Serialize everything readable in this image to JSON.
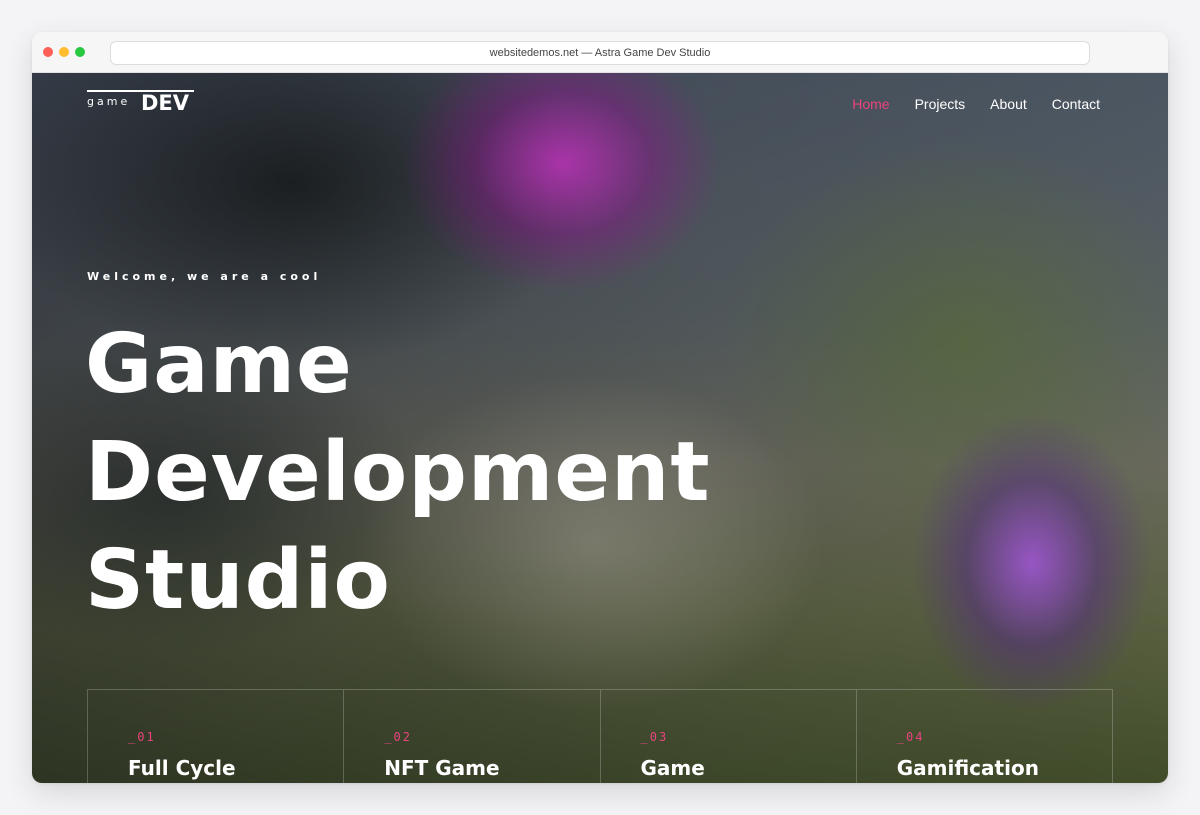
{
  "browser": {
    "address_text": "websitedemos.net — Astra Game Dev Studio"
  },
  "logo": {
    "small": "game",
    "large": "DEV"
  },
  "nav": {
    "items": [
      {
        "label": "Home",
        "active": true
      },
      {
        "label": "Projects",
        "active": false
      },
      {
        "label": "About",
        "active": false
      },
      {
        "label": "Contact",
        "active": false
      }
    ]
  },
  "hero": {
    "tagline": "Welcome, we are a cool",
    "headline_lines": [
      "Game",
      "Development",
      "Studio"
    ]
  },
  "services": [
    {
      "number": "_01",
      "title": "Full Cycle"
    },
    {
      "number": "_02",
      "title": "NFT Game"
    },
    {
      "number": "_03",
      "title": "Game"
    },
    {
      "number": "_04",
      "title": "Gamification"
    }
  ],
  "colors": {
    "accent": "#e9447d",
    "text": "#ffffff"
  }
}
